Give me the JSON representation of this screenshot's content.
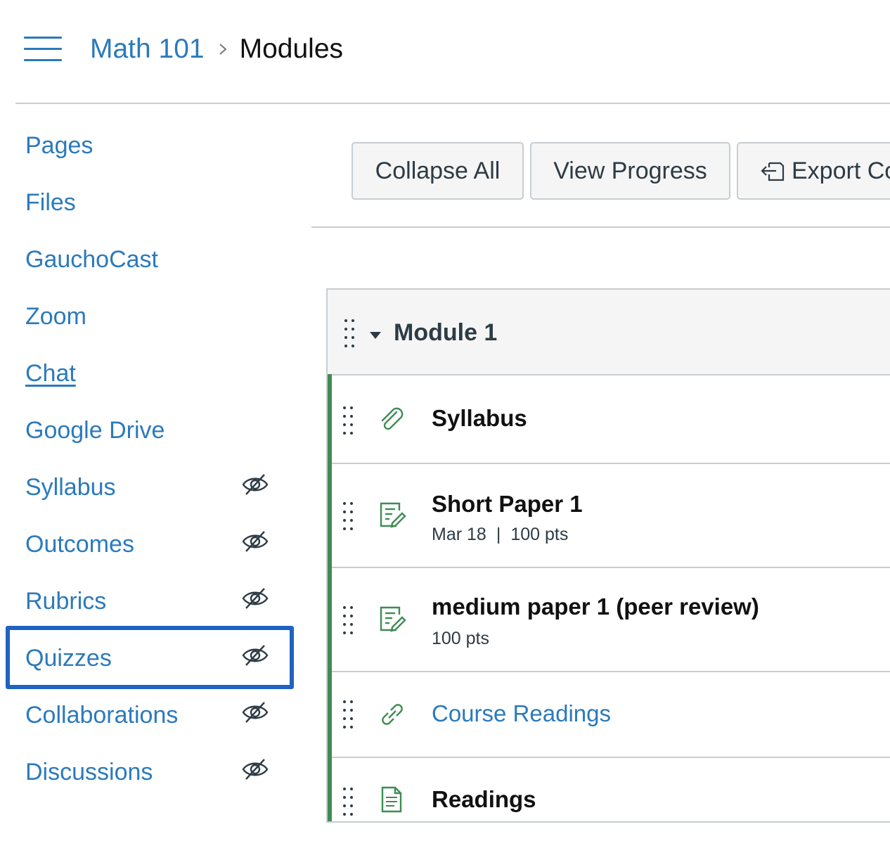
{
  "header": {
    "menu_icon": "hamburger-icon",
    "breadcrumb_course": "Math 101",
    "breadcrumb_separator_icon": "chevron-right-icon",
    "breadcrumb_current": "Modules"
  },
  "sidebar": {
    "items": [
      {
        "label": "Pages",
        "hidden": false
      },
      {
        "label": "Files",
        "hidden": false
      },
      {
        "label": "GauchoCast",
        "hidden": false
      },
      {
        "label": "Zoom",
        "hidden": false
      },
      {
        "label": "Chat",
        "hidden": false,
        "hovered": true
      },
      {
        "label": "Google Drive",
        "hidden": false
      },
      {
        "label": "Syllabus",
        "hidden": true
      },
      {
        "label": "Outcomes",
        "hidden": true
      },
      {
        "label": "Rubrics",
        "hidden": true
      },
      {
        "label": "Quizzes",
        "hidden": true,
        "focused": true
      },
      {
        "label": "Collaborations",
        "hidden": true
      },
      {
        "label": "Discussions",
        "hidden": true
      }
    ],
    "hidden_icon": "eye-slash-icon",
    "focus_color": "#1f63c0"
  },
  "toolbar": {
    "collapse_all": "Collapse All",
    "view_progress": "View Progress",
    "export": "Export Co",
    "export_icon": "export-icon"
  },
  "module": {
    "title": "Module 1",
    "expanded": true,
    "published_color": "#3e8c53",
    "items": [
      {
        "title": "Syllabus",
        "icon": "attachment-icon",
        "link": false,
        "date": "",
        "points": ""
      },
      {
        "title": "Short Paper 1",
        "icon": "assignment-icon",
        "link": false,
        "date": "Mar 18",
        "points": "100 pts",
        "separator": "|"
      },
      {
        "title": "medium paper 1 (peer review)",
        "icon": "assignment-icon",
        "link": false,
        "date": "",
        "points": "100 pts"
      },
      {
        "title": "Course Readings",
        "icon": "link-icon",
        "link": true,
        "date": "",
        "points": ""
      },
      {
        "title": "Readings",
        "icon": "page-icon",
        "link": false,
        "date": "",
        "points": ""
      }
    ]
  },
  "colors": {
    "link": "#2b7abc",
    "text": "#2d3b45",
    "border": "#c7cdd1",
    "button_bg": "#f5f5f5"
  }
}
